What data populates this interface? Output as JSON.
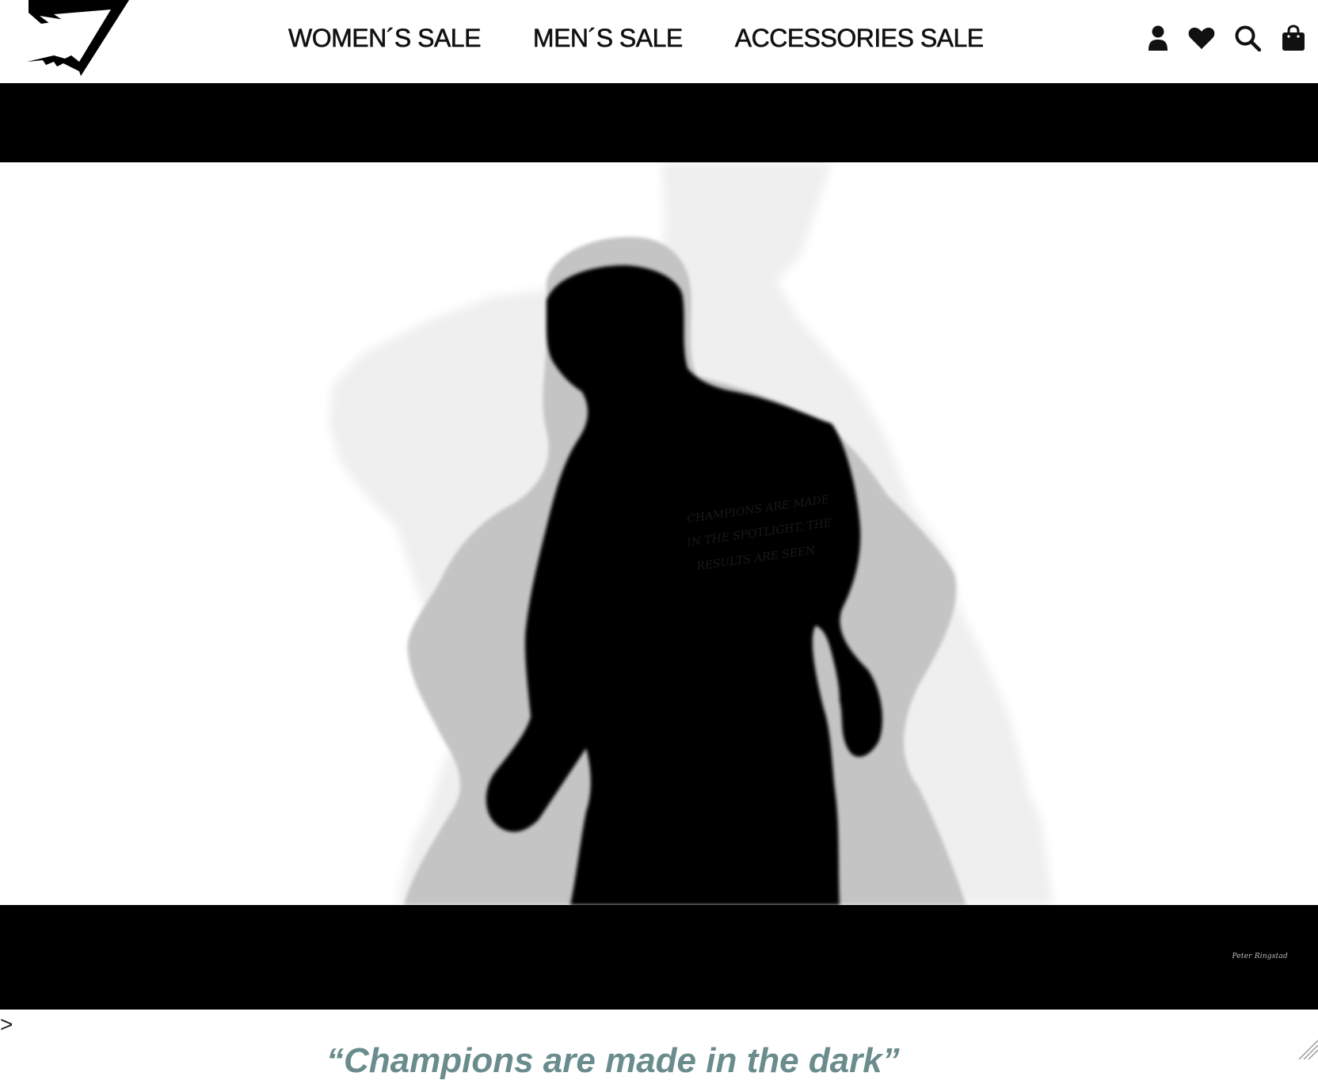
{
  "header": {
    "logo_icon": "gymshark-logo-icon",
    "nav": [
      {
        "label": "WOMEN´S SALE"
      },
      {
        "label": "MEN´S SALE"
      },
      {
        "label": "ACCESSORIES SALE"
      }
    ],
    "icons": [
      {
        "name": "account-icon"
      },
      {
        "name": "wishlist-heart-icon"
      },
      {
        "name": "search-icon"
      },
      {
        "name": "bag-icon"
      }
    ]
  },
  "hero": {
    "media": "video",
    "signature": "Peter Ringstad"
  },
  "below": {
    "stray_text": ">",
    "heading": "“Champions are made in the dark”"
  },
  "colors": {
    "text": "#111111",
    "letterbox": "#000000",
    "heading_accent": "#6a8c8c"
  }
}
